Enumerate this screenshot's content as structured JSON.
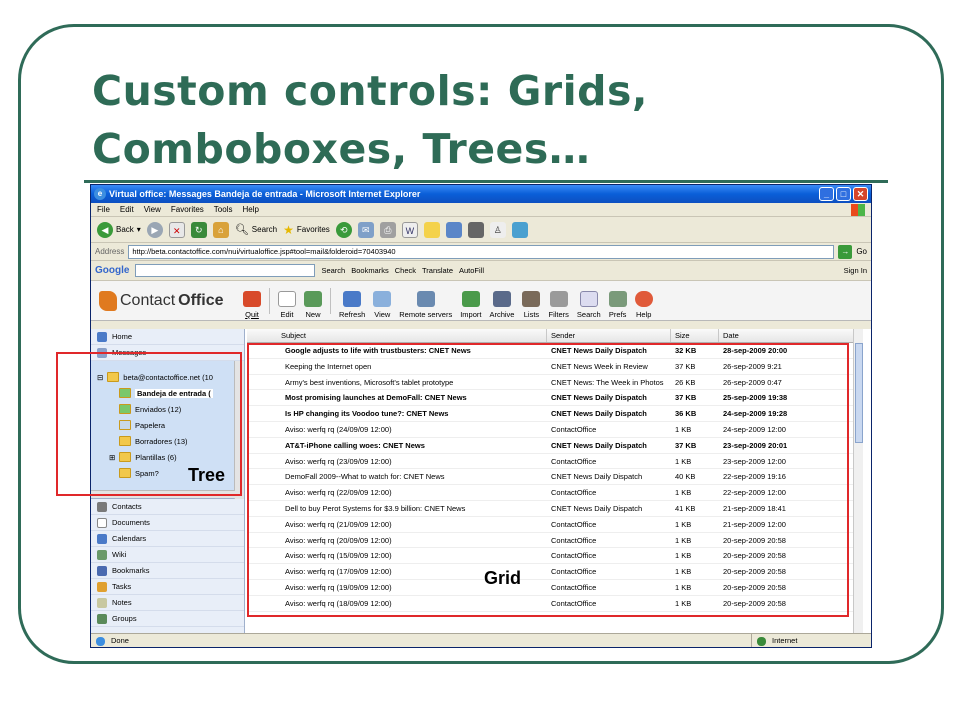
{
  "slide": {
    "title_line1": "Custom controls: Grids,",
    "title_line2": "Comboboxes, Trees…",
    "annotation_tree": "Tree",
    "annotation_grid": "Grid"
  },
  "browser": {
    "window_title": "Virtual office: Messages Bandeja de entrada - Microsoft Internet Explorer",
    "menu": [
      "File",
      "Edit",
      "View",
      "Favorites",
      "Tools",
      "Help"
    ],
    "toolbar": {
      "back": "Back",
      "search": "Search",
      "favorites": "Favorites"
    },
    "address_label": "Address",
    "address_value": "http://beta.contactoffice.com/nui/virtualoffice.jsp#tool=mail&folderoid=70403940",
    "go_label": "Go",
    "googlebar": {
      "logo": "Google",
      "search": "Search",
      "bookmarks": "Bookmarks",
      "check": "Check",
      "translate": "Translate",
      "autofill": "AutoFill",
      "signin": "Sign In"
    },
    "status_left": "Done",
    "status_zone": "Internet"
  },
  "app": {
    "logo_light": "Contact",
    "logo_bold": "Office",
    "buttons": [
      "Quit",
      "Edit",
      "New",
      "Refresh",
      "View",
      "Remote servers",
      "Import",
      "Archive",
      "Lists",
      "Filters",
      "Search",
      "Prefs",
      "Help"
    ],
    "sidebar_top": [
      "Home",
      "Messages"
    ],
    "tree": {
      "account": "beta@contactoffice.net  (10",
      "folders": [
        {
          "label": "Bandeja de entrada  (",
          "selected": true
        },
        {
          "label": "Enviados  (12)",
          "selected": false
        },
        {
          "label": "Papelera",
          "selected": false
        },
        {
          "label": "Borradores  (13)",
          "selected": false
        },
        {
          "label": "Plantillas  (6)",
          "selected": false
        },
        {
          "label": "Spam?",
          "selected": false
        }
      ]
    },
    "sidebar_bottom": [
      "Contacts",
      "Documents",
      "Calendars",
      "Wiki",
      "Bookmarks",
      "Tasks",
      "Notes",
      "Groups"
    ],
    "grid": {
      "columns": [
        "Subject",
        "Sender",
        "Size",
        "Date"
      ],
      "rows": [
        {
          "subject": "Google adjusts to life with trustbusters: CNET News",
          "sender": "CNET News Daily Dispatch",
          "size": "32 KB",
          "date": "28-sep-2009 20:00",
          "unread": true
        },
        {
          "subject": "Keeping the Internet open",
          "sender": "CNET News Week in Review",
          "size": "37 KB",
          "date": "26-sep-2009 9:21",
          "unread": false
        },
        {
          "subject": "Army's best inventions, Microsoft's tablet prototype",
          "sender": "CNET News: The Week in Photos",
          "size": "26 KB",
          "date": "26-sep-2009 0:47",
          "unread": false
        },
        {
          "subject": "Most promising launches at DemoFall: CNET News",
          "sender": "CNET News Daily Dispatch",
          "size": "37 KB",
          "date": "25-sep-2009 19:38",
          "unread": true
        },
        {
          "subject": "Is HP changing its Voodoo tune?: CNET News",
          "sender": "CNET News Daily Dispatch",
          "size": "36 KB",
          "date": "24-sep-2009 19:28",
          "unread": true
        },
        {
          "subject": "Aviso: werfq rq (24/09/09 12:00)",
          "sender": "ContactOffice",
          "size": "1 KB",
          "date": "24-sep-2009 12:00",
          "unread": false
        },
        {
          "subject": "AT&T-iPhone calling woes: CNET News",
          "sender": "CNET News Daily Dispatch",
          "size": "37 KB",
          "date": "23-sep-2009 20:01",
          "unread": true
        },
        {
          "subject": "Aviso: werfq rq (23/09/09 12:00)",
          "sender": "ContactOffice",
          "size": "1 KB",
          "date": "23-sep-2009 12:00",
          "unread": false
        },
        {
          "subject": "DemoFall 2009--What to watch for: CNET News",
          "sender": "CNET News Daily Dispatch",
          "size": "40 KB",
          "date": "22-sep-2009 19:16",
          "unread": false
        },
        {
          "subject": "Aviso: werfq rq (22/09/09 12:00)",
          "sender": "ContactOffice",
          "size": "1 KB",
          "date": "22-sep-2009 12:00",
          "unread": false
        },
        {
          "subject": "Dell to buy Perot Systems for $3.9 billion: CNET News",
          "sender": "CNET News Daily Dispatch",
          "size": "41 KB",
          "date": "21-sep-2009 18:41",
          "unread": false
        },
        {
          "subject": "Aviso: werfq rq (21/09/09 12:00)",
          "sender": "ContactOffice",
          "size": "1 KB",
          "date": "21-sep-2009 12:00",
          "unread": false
        },
        {
          "subject": "Aviso: werfq rq (20/09/09 12:00)",
          "sender": "ContactOffice",
          "size": "1 KB",
          "date": "20-sep-2009 20:58",
          "unread": false
        },
        {
          "subject": "Aviso: werfq rq (15/09/09 12:00)",
          "sender": "ContactOffice",
          "size": "1 KB",
          "date": "20-sep-2009 20:58",
          "unread": false
        },
        {
          "subject": "Aviso: werfq rq (17/09/09 12:00)",
          "sender": "ContactOffice",
          "size": "1 KB",
          "date": "20-sep-2009 20:58",
          "unread": false
        },
        {
          "subject": "Aviso: werfq rq (19/09/09 12:00)",
          "sender": "ContactOffice",
          "size": "1 KB",
          "date": "20-sep-2009 20:58",
          "unread": false
        },
        {
          "subject": "Aviso: werfq rq (18/09/09 12:00)",
          "sender": "ContactOffice",
          "size": "1 KB",
          "date": "20-sep-2009 20:58",
          "unread": false
        }
      ]
    }
  }
}
